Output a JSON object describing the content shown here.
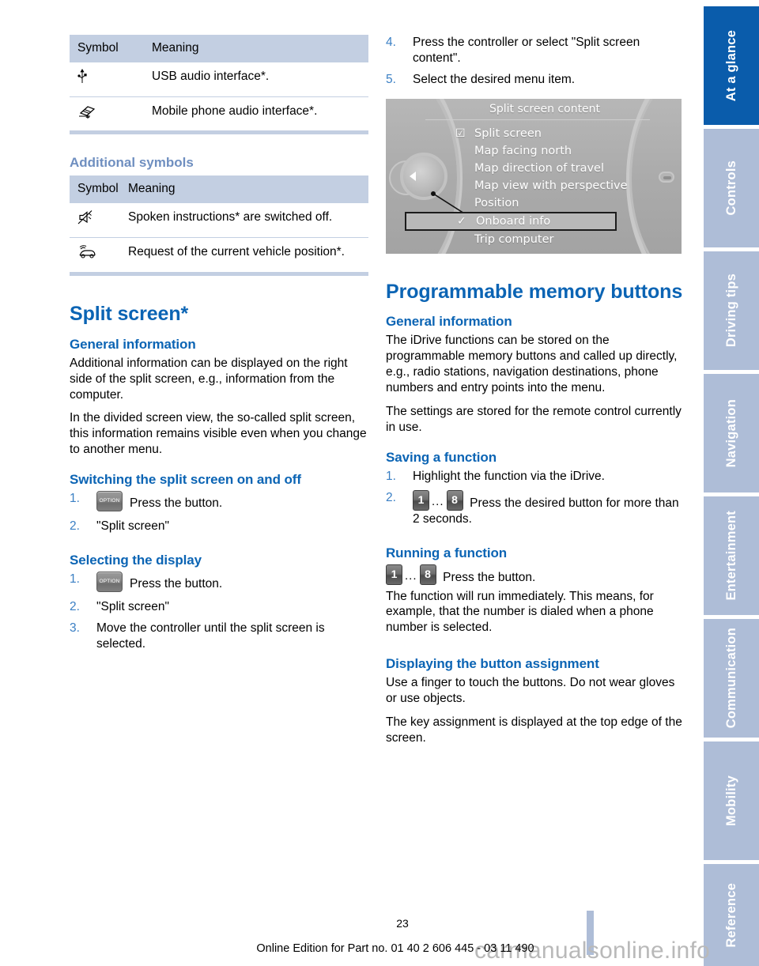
{
  "tables": {
    "interface_symbols": {
      "headers": [
        "Symbol",
        "Meaning"
      ],
      "rows": [
        {
          "symbol": "usb-icon",
          "glyph": "⚲",
          "meaning": "USB audio interface*."
        },
        {
          "symbol": "mobile-phone-audio-icon",
          "glyph": "✇",
          "meaning": "Mobile phone audio interface*."
        }
      ]
    },
    "additional_symbols": {
      "section_title": "Additional symbols",
      "headers": [
        "Symbol",
        "Meaning"
      ],
      "rows": [
        {
          "symbol": "muted-speaker-icon",
          "glyph": "🔇",
          "meaning": "Spoken instructions* are switched off."
        },
        {
          "symbol": "vehicle-position-icon",
          "glyph": "🚗",
          "meaning": "Request of the current vehicle position*."
        }
      ]
    }
  },
  "split_screen": {
    "title": "Split screen*",
    "general_information": {
      "heading": "General information",
      "paragraphs": [
        "Additional information can be displayed on the right side of the split screen, e.g., information from the computer.",
        "In the divided screen view, the so-called split screen, this information remains visible even when you change to another menu."
      ]
    },
    "switching": {
      "heading": "Switching the split screen on and off",
      "steps": [
        {
          "num": "1.",
          "icon": "option-button",
          "icon_label": "OPTION",
          "text": "Press the button."
        },
        {
          "num": "2.",
          "text": "\"Split screen\""
        }
      ]
    },
    "selecting": {
      "heading": "Selecting the display",
      "steps": [
        {
          "num": "1.",
          "icon": "option-button",
          "icon_label": "OPTION",
          "text": "Press the button."
        },
        {
          "num": "2.",
          "text": "\"Split screen\""
        },
        {
          "num": "3.",
          "text": "Move the controller until the split screen is selected."
        },
        {
          "num": "4.",
          "text": "Press the controller or select \"Split screen content\"."
        },
        {
          "num": "5.",
          "text": "Select the desired menu item."
        }
      ]
    }
  },
  "idrive_screenshot": {
    "title": "Split screen content",
    "menu_items": [
      {
        "label": "Split screen",
        "mark": "☑",
        "selected": false
      },
      {
        "label": "Map facing north",
        "mark": "",
        "selected": false
      },
      {
        "label": "Map direction of travel",
        "mark": "",
        "selected": false
      },
      {
        "label": "Map view with perspective",
        "mark": "",
        "selected": false
      },
      {
        "label": "Position",
        "mark": "",
        "selected": false
      },
      {
        "label": "Onboard info",
        "mark": "✓",
        "selected": true
      },
      {
        "label": "Trip computer",
        "mark": "",
        "selected": false
      }
    ]
  },
  "memory_buttons": {
    "title": "Programmable memory buttons",
    "general_information": {
      "heading": "General information",
      "paragraphs": [
        "The iDrive functions can be stored on the programmable memory buttons and called up directly, e.g., radio stations, navigation destinations, phone numbers and entry points into the menu.",
        "The settings are stored for the remote control currently in use."
      ]
    },
    "saving": {
      "heading": "Saving a function",
      "steps": [
        {
          "num": "1.",
          "text": "Highlight the function via the iDrive."
        },
        {
          "num": "2.",
          "icon_first": "1",
          "icon_dots": "...",
          "icon_last": "8",
          "text": "Press the desired button for more than 2 seconds."
        }
      ]
    },
    "running": {
      "heading": "Running a function",
      "icon_first": "1",
      "icon_dots": "...",
      "icon_last": "8",
      "line1": "Press the button.",
      "line2": "The function will run immediately. This means, for example, that the number is dialed when a phone number is selected."
    },
    "displaying": {
      "heading": "Displaying the button assignment",
      "paragraphs": [
        "Use a finger to touch the buttons. Do not wear gloves or use objects.",
        "The key assignment is displayed at the top edge of the screen."
      ]
    }
  },
  "sidebar": {
    "tabs": [
      {
        "label": "At a glance",
        "active": true
      },
      {
        "label": "Controls",
        "active": false
      },
      {
        "label": "Driving tips",
        "active": false
      },
      {
        "label": "Navigation",
        "active": false
      },
      {
        "label": "Entertainment",
        "active": false
      },
      {
        "label": "Communication",
        "active": false
      },
      {
        "label": "Mobility",
        "active": false
      },
      {
        "label": "Reference",
        "active": false
      }
    ]
  },
  "footer": {
    "page_number": "23",
    "edition_line": "Online Edition for Part no. 01 40 2 606 445 - 03 11 490",
    "watermark": "carmanualsonline.info"
  },
  "colors": {
    "accent_blue": "#0b64b4",
    "tab_active": "#0a5cab",
    "tab_inactive": "#aebdd7",
    "table_header": "#c3cfe2",
    "step_number": "#3a7fc4",
    "sub_heading_light": "#6f8fc0"
  }
}
